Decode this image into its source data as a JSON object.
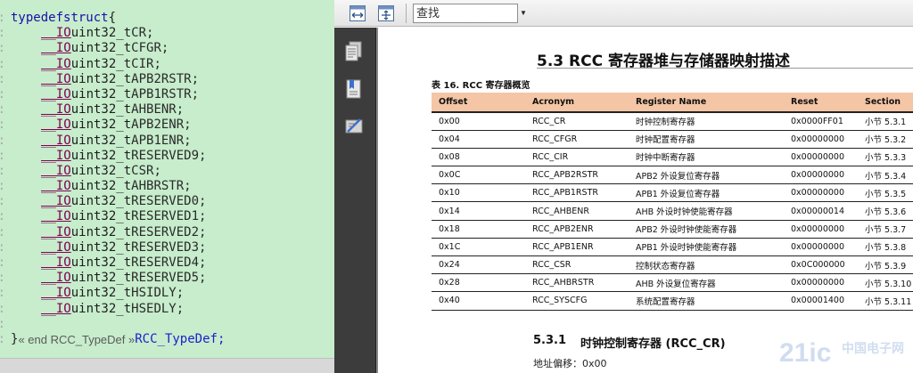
{
  "editor": {
    "line_numbers": [
      "9:",
      "0:",
      "1:",
      "2:",
      "3:",
      "4:",
      "5:",
      "6:",
      "7:",
      "8:",
      "9:",
      "0:",
      "1:",
      "2:",
      "3:",
      "4:",
      "5:",
      "6:",
      "7:",
      "8:",
      "9:",
      "0:",
      "1:"
    ],
    "struct_open_kw1": "typedef",
    "struct_open_kw2": "struct",
    "struct_open_brace": "{",
    "io_macro": "__IO",
    "field_type": "uint32_t",
    "fields": [
      "CR;",
      "CFGR;",
      "CIR;",
      "APB2RSTR;",
      "APB1RSTR;",
      "AHBENR;",
      "APB2ENR;",
      "APB1ENR;",
      "RESERVED9;",
      "CSR;",
      "AHBRSTR;",
      "RESERVED0;",
      "RESERVED1;",
      "RESERVED2;",
      "RESERVED3;",
      "RESERVED4;",
      "RESERVED5;",
      "HSIDLY;",
      "HSEDLY;"
    ],
    "close_brace": "}",
    "fold_comment": "« end RCC_TypeDef »",
    "type_name": "RCC_TypeDef;"
  },
  "toolbar": {
    "fit_width_icon": "fit-width-icon",
    "fit_page_icon": "fit-page-icon",
    "find_value": "查找"
  },
  "sidebar": {
    "icons": [
      "pages-icon",
      "bookmarks-icon",
      "annotations-icon"
    ]
  },
  "document": {
    "section_title": "5.3  RCC 寄存器堆与存储器映射描述",
    "table_caption": "表 16. RCC 寄存器概览",
    "table_headers": [
      "Offset",
      "Acronym",
      "Register Name",
      "Reset",
      "Section"
    ],
    "table_rows": [
      [
        "0x00",
        "RCC_CR",
        "时钟控制寄存器",
        "0x0000FF01",
        "小节 5.3.1"
      ],
      [
        "0x04",
        "RCC_CFGR",
        "时钟配置寄存器",
        "0x00000000",
        "小节 5.3.2"
      ],
      [
        "0x08",
        "RCC_CIR",
        "时钟中断寄存器",
        "0x00000000",
        "小节 5.3.3"
      ],
      [
        "0x0C",
        "RCC_APB2RSTR",
        "APB2 外设复位寄存器",
        "0x00000000",
        "小节 5.3.4"
      ],
      [
        "0x10",
        "RCC_APB1RSTR",
        "APB1 外设复位寄存器",
        "0x00000000",
        "小节 5.3.5"
      ],
      [
        "0x14",
        "RCC_AHBENR",
        "AHB 外设时钟使能寄存器",
        "0x00000014",
        "小节 5.3.6"
      ],
      [
        "0x18",
        "RCC_APB2ENR",
        "APB2 外设时钟使能寄存器",
        "0x00000000",
        "小节 5.3.7"
      ],
      [
        "0x1C",
        "RCC_APB1ENR",
        "APB1 外设时钟使能寄存器",
        "0x00000000",
        "小节 5.3.8"
      ],
      [
        "0x24",
        "RCC_CSR",
        "控制状态寄存器",
        "0x0C000000",
        "小节 5.3.9"
      ],
      [
        "0x28",
        "RCC_AHBRSTR",
        "AHB 外设复位寄存器",
        "0x00000000",
        "小节 5.3.10"
      ],
      [
        "0x40",
        "RCC_SYSCFG",
        "系统配置寄存器",
        "0x00001400",
        "小节 5.3.11"
      ]
    ],
    "subsection_num": "5.3.1",
    "subsection_title": "时钟控制寄存器 (RCC_CR)",
    "address_offset": "地址偏移：0x00",
    "watermark_text": "21ic 中国电子网"
  }
}
